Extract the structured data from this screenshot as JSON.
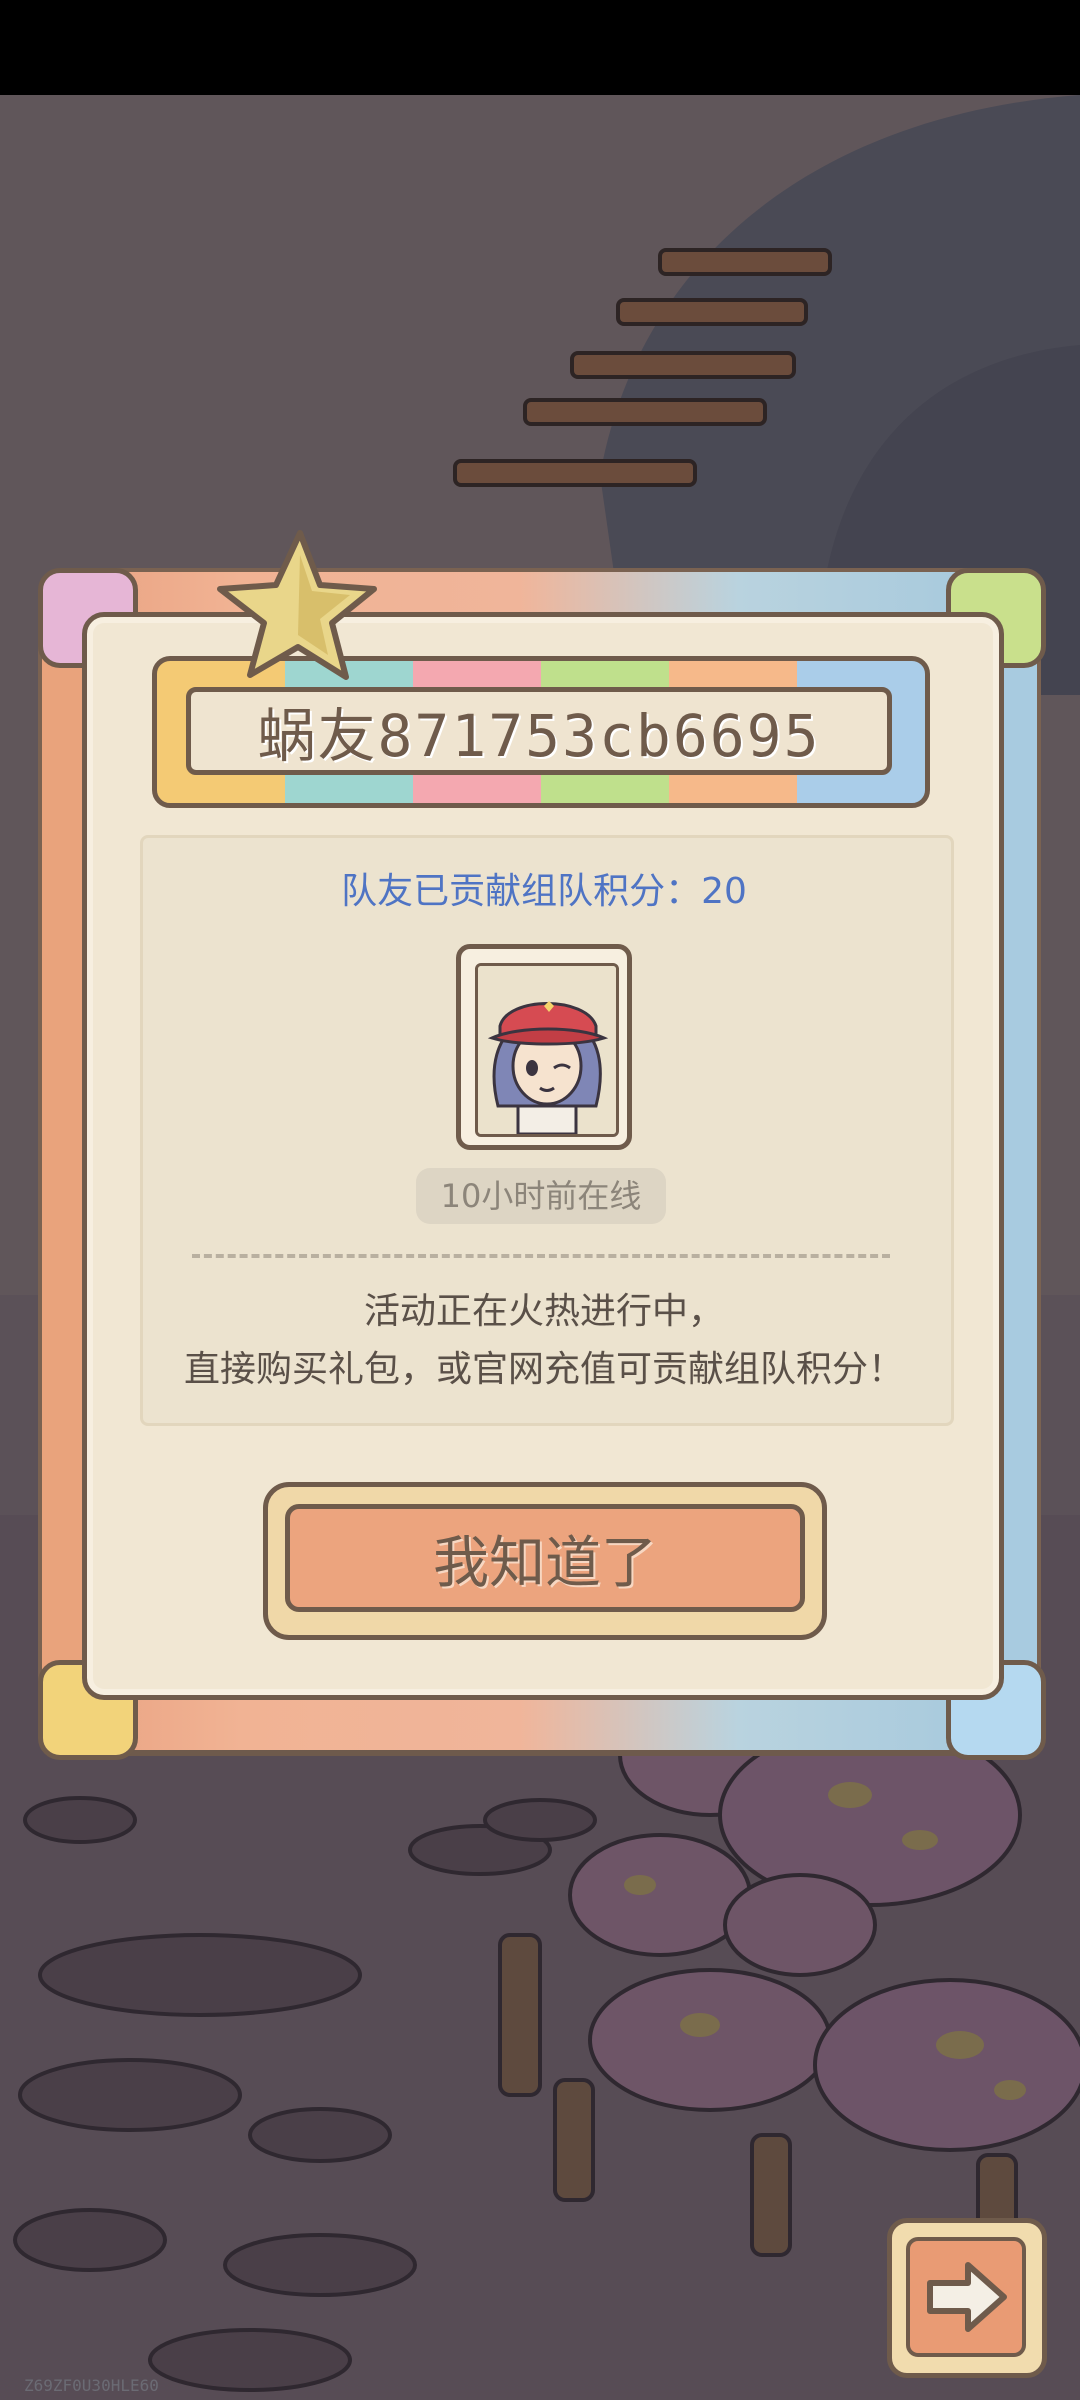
{
  "dialog": {
    "player_name": "蜗友871753cb6695",
    "contribution_text": "队友已贡献组队积分：20",
    "last_online": "10小时前在线",
    "message_line1": "活动正在火热进行中，",
    "message_line2": "直接购买礼包，或官网充值可贡献组队积分！",
    "confirm_label": "我知道了"
  },
  "next_button": {
    "icon": "arrow-right-icon"
  },
  "device_id": "Z69ZF0U30HLE60",
  "colors": {
    "accent_blue": "#4f74c4",
    "button_orange": "#eca47e",
    "outline_brown": "#6f5b4b"
  }
}
